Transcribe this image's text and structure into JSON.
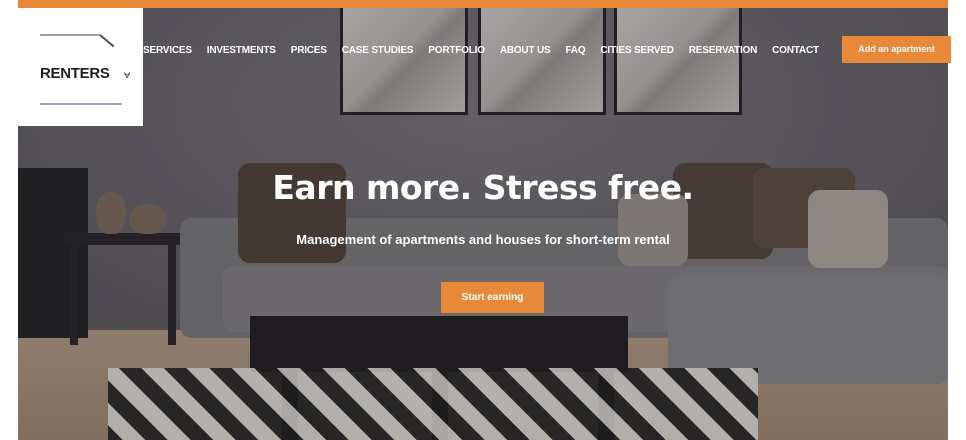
{
  "brand": {
    "logo_text": "RENTERS",
    "logo_mark": "⩝"
  },
  "nav": {
    "items": [
      {
        "label": "SERVICES"
      },
      {
        "label": "INVESTMENTS"
      },
      {
        "label": "PRICES"
      },
      {
        "label": "CASE STUDIES"
      },
      {
        "label": "PORTFOLIO"
      },
      {
        "label": "ABOUT US"
      },
      {
        "label": "FAQ"
      },
      {
        "label": "CITIES SERVED"
      },
      {
        "label": "RESERVATION"
      },
      {
        "label": "CONTACT"
      }
    ],
    "cta_label": "Add an apartment"
  },
  "hero": {
    "headline": "Earn more. Stress free.",
    "subheadline": "Management of apartments and houses for short-term rental",
    "cta_label": "Start earning"
  },
  "colors": {
    "accent": "#e8893a",
    "text_on_hero": "#ffffff",
    "logo_bg": "#ffffff"
  }
}
